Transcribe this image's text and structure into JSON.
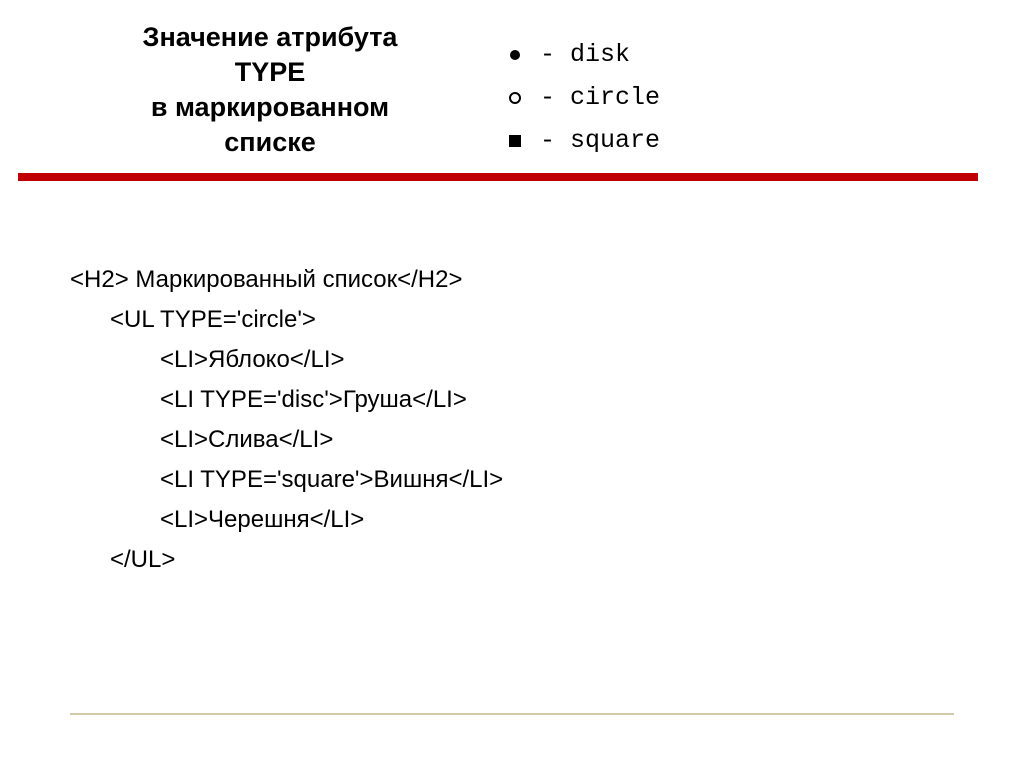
{
  "title": {
    "line1": "Значение атрибута",
    "line2": "TYPE",
    "line3": "в маркированном",
    "line4": "списке"
  },
  "bulletTypes": {
    "disk": "- disk",
    "circle": "- circle",
    "square": "- square"
  },
  "code": {
    "l1": "<H2> Маркированный список</H2>",
    "l2": "<UL TYPE='circle'>",
    "l3": "<LI>Яблоко</LI>",
    "l4": "<LI TYPE='disc'>Груша</LI>",
    "l5": "<LI>Слива</LI>",
    "l6": "<LI TYPE='square'>Вишня</LI>",
    "l7": "<LI>Черешня</LI>",
    "l8": "</UL>"
  }
}
